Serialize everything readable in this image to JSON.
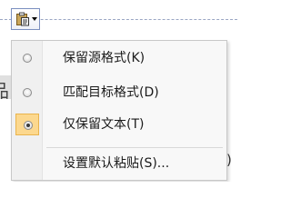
{
  "paste_options": {
    "icon": "clipboard-icon",
    "dropdown_icon": "chevron-down-icon"
  },
  "document": {
    "left_glyph": "品",
    "right_glyph": ")"
  },
  "menu": {
    "items": [
      {
        "label": "保留源格式(K)",
        "checked": false
      },
      {
        "label": "匹配目标格式(D)",
        "checked": false
      },
      {
        "label": "仅保留文本(T)",
        "checked": true
      },
      {
        "label": "设置默认粘贴(S)...",
        "checked": null
      }
    ],
    "highlight_color": "#fcd88e"
  }
}
